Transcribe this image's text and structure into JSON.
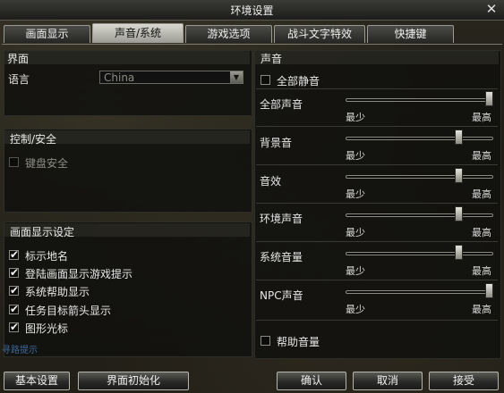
{
  "window": {
    "title": "环境设置",
    "close_glyph": "✕"
  },
  "tabs": [
    {
      "label": "画面显示"
    },
    {
      "label": "声音/系统"
    },
    {
      "label": "游戏选项"
    },
    {
      "label": "战斗文字特效"
    },
    {
      "label": "快捷键"
    }
  ],
  "interface": {
    "title": "界面",
    "language_label": "语言",
    "language_value": "China"
  },
  "control": {
    "title": "控制/安全",
    "keyboard_security_label": "键盘安全"
  },
  "display": {
    "title": "画面显示设定",
    "items": [
      {
        "label": "标示地名",
        "checked": true
      },
      {
        "label": "登陆画面显示游戏提示",
        "checked": true
      },
      {
        "label": "系统帮助显示",
        "checked": true
      },
      {
        "label": "任务目标箭头显示",
        "checked": true
      },
      {
        "label": "图形光标",
        "checked": true
      }
    ]
  },
  "sound": {
    "title": "声音",
    "mute_all_label": "全部静音",
    "min_label": "最少",
    "max_label": "最高",
    "sliders": [
      {
        "label": "全部声音",
        "value": 1.0
      },
      {
        "label": "背景音",
        "value": 0.78
      },
      {
        "label": "音效",
        "value": 0.78
      },
      {
        "label": "环境声音",
        "value": 0.78
      },
      {
        "label": "系统音量",
        "value": 0.78
      },
      {
        "label": "NPC声音",
        "value": 1.0
      }
    ],
    "help_volume_label": "帮助音量"
  },
  "buttons": {
    "basic_settings": "基本设置",
    "reset_ui": "界面初始化",
    "confirm": "确认",
    "cancel": "取消",
    "apply": "接受"
  },
  "background_text": "寻路提示"
}
